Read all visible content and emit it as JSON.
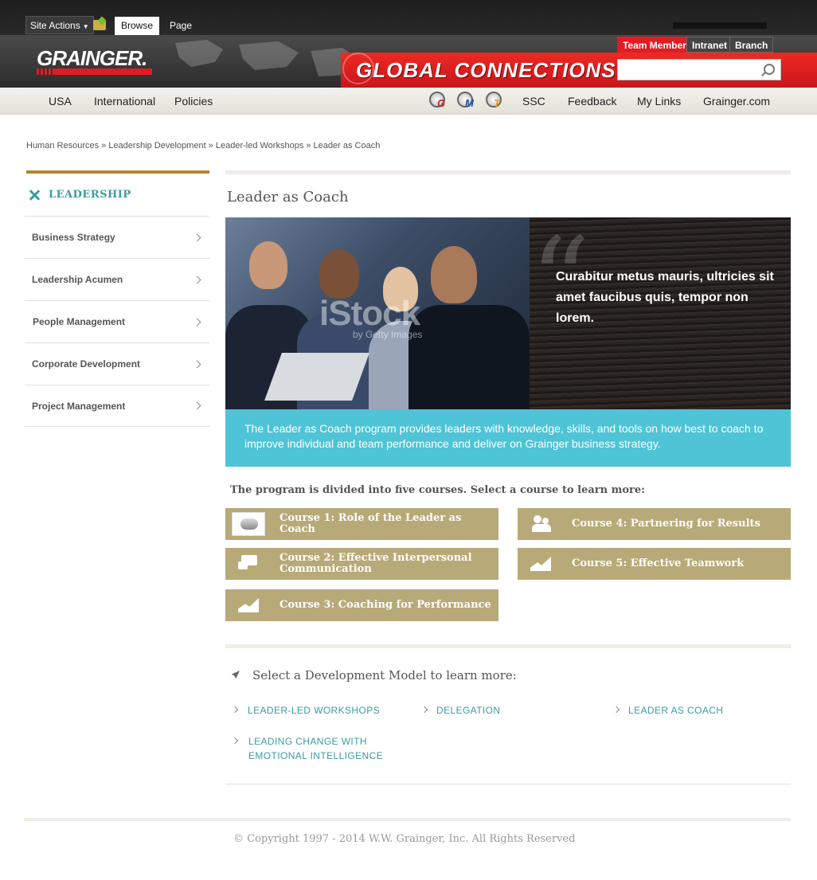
{
  "ribbon": {
    "site_actions": "Site Actions",
    "tabs": [
      "Browse",
      "Page"
    ]
  },
  "banner": {
    "logo": "GRAINGER.",
    "title": "GLOBAL CONNECTIONS",
    "audience_tabs": [
      "Team Member",
      "Intranet",
      "Branch"
    ],
    "search_value": ""
  },
  "nav": {
    "left_links": [
      "USA",
      "International",
      "Policies"
    ],
    "portal_icons": [
      {
        "letter": "G",
        "color": "#e31b23"
      },
      {
        "letter": "M",
        "color": "#1f4fa0"
      },
      {
        "letter": "T",
        "color": "#f39c12"
      }
    ],
    "right_links": [
      "SSC",
      "Feedback",
      "My Links",
      "Grainger.com"
    ]
  },
  "breadcrumb": "Human Resources » Leadership Development » Leader-led Workshops » Leader as Coach",
  "sidebar": {
    "heading": "LEADERSHIP",
    "items": [
      "Business Strategy",
      "Leadership Acumen",
      "People Management",
      "Corporate Development",
      "Project Management"
    ]
  },
  "main": {
    "title": "Leader as Coach",
    "hero": {
      "watermark": "iStock",
      "watermark_sub": "by Getty Images",
      "quote": "Curabitur metus mauris, ultricies sit amet faucibus quis, tempor non lorem."
    },
    "intro": "The Leader as Coach program provides leaders with knowledge, skills, and tools on how best to coach to improve individual and team performance and deliver on Grainger business strategy.",
    "courses_heading": "The program is divided into five courses.  Select a course to learn more:",
    "courses": [
      {
        "label": "Course 1: Role of the Leader as Coach",
        "icon": "whistle-icon"
      },
      {
        "label": "Course 2: Effective Interpersonal Communication",
        "icon": "chat-icon"
      },
      {
        "label": "Course 3: Coaching for Performance",
        "icon": "growth-chart-icon"
      },
      {
        "label": "Course 4: Partnering for Results",
        "icon": "people-icon"
      },
      {
        "label": "Course 5: Effective Teamwork",
        "icon": "growth-chart-icon"
      }
    ],
    "dev_heading": "Select a Development Model to learn more:",
    "models": [
      "LEADER-LED WORKSHOPS",
      "DELEGATION",
      "LEADER AS COACH",
      "LEADING CHANGE WITH EMOTIONAL INTELLIGENCE"
    ]
  },
  "footer": {
    "copyright": "© Copyright 1997 - 2014 W.W. Grainger, Inc. All Rights Reserved"
  },
  "colors": {
    "brand_red": "#e31b23",
    "accent_teal": "#3d9aa4",
    "intro_bg": "#4ec4d6",
    "course_bg": "#b8a978",
    "sidebar_accent": "#b5852e"
  }
}
